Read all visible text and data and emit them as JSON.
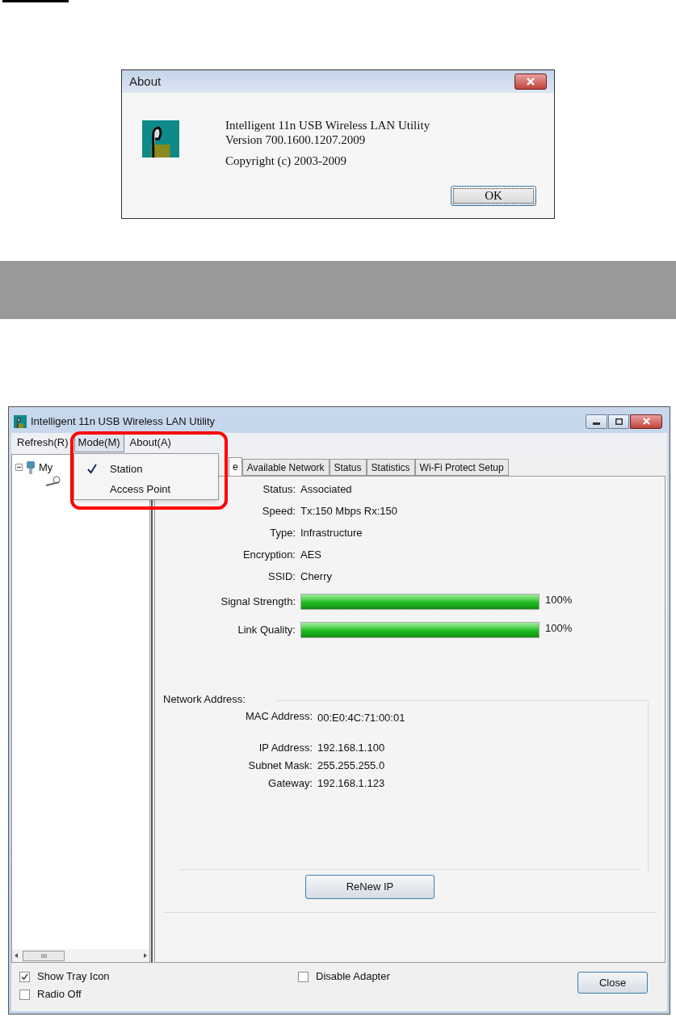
{
  "about_dialog": {
    "title": "About",
    "lines": [
      "Intelligent 11n USB Wireless LAN Utility",
      "Version 700.1600.1207.2009"
    ],
    "copyright": "Copyright (c) 2003-2009",
    "ok_button": "OK"
  },
  "window": {
    "title": "Intelligent 11n USB Wireless LAN Utility",
    "menu": [
      {
        "label": "Refresh(R)",
        "selected": false
      },
      {
        "label": "Mode(M)",
        "selected": true
      },
      {
        "label": "About(A)",
        "selected": false
      }
    ],
    "dropdown": [
      {
        "label": "Station",
        "checked": true
      },
      {
        "label": "Access Point",
        "checked": false
      }
    ],
    "tree": {
      "label": "My",
      "expanded": true
    },
    "tabs": [
      {
        "label": "e",
        "selected": true
      },
      {
        "label": "Available Network",
        "selected": false
      },
      {
        "label": "Status",
        "selected": false
      },
      {
        "label": "Statistics",
        "selected": false
      },
      {
        "label": "Wi-Fi Protect Setup",
        "selected": false
      }
    ],
    "fields": [
      {
        "label": "Status:",
        "value": "Associated"
      },
      {
        "label": "Speed:",
        "value": "Tx:150 Mbps Rx:150"
      },
      {
        "label": "Type:",
        "value": "Infrastructure"
      },
      {
        "label": "Encryption:",
        "value": "AES"
      },
      {
        "label": "SSID:",
        "value": "Cherry"
      }
    ],
    "meters": [
      {
        "label": "Signal Strength:",
        "level": 1,
        "reading": "100%"
      },
      {
        "label": "Link Quality:",
        "level": 1,
        "reading": "100%"
      }
    ],
    "network_heading": "Network Address:",
    "network_fields": [
      {
        "label": "MAC Address:",
        "value": "00:E0:4C:71:00:01"
      },
      {
        "label": "IP Address:",
        "value": "192.168.1.100"
      },
      {
        "label": "Subnet Mask:",
        "value": "255.255.255.0"
      },
      {
        "label": "Gateway:",
        "value": "192.168.1.123"
      }
    ],
    "renew_button": "ReNew IP",
    "checkboxes": [
      {
        "label": "Show Tray Icon",
        "checked": true
      },
      {
        "label": "Radio Off",
        "checked": false
      },
      {
        "label": "Disable Adapter",
        "checked": false
      }
    ],
    "close_button": "Close"
  }
}
